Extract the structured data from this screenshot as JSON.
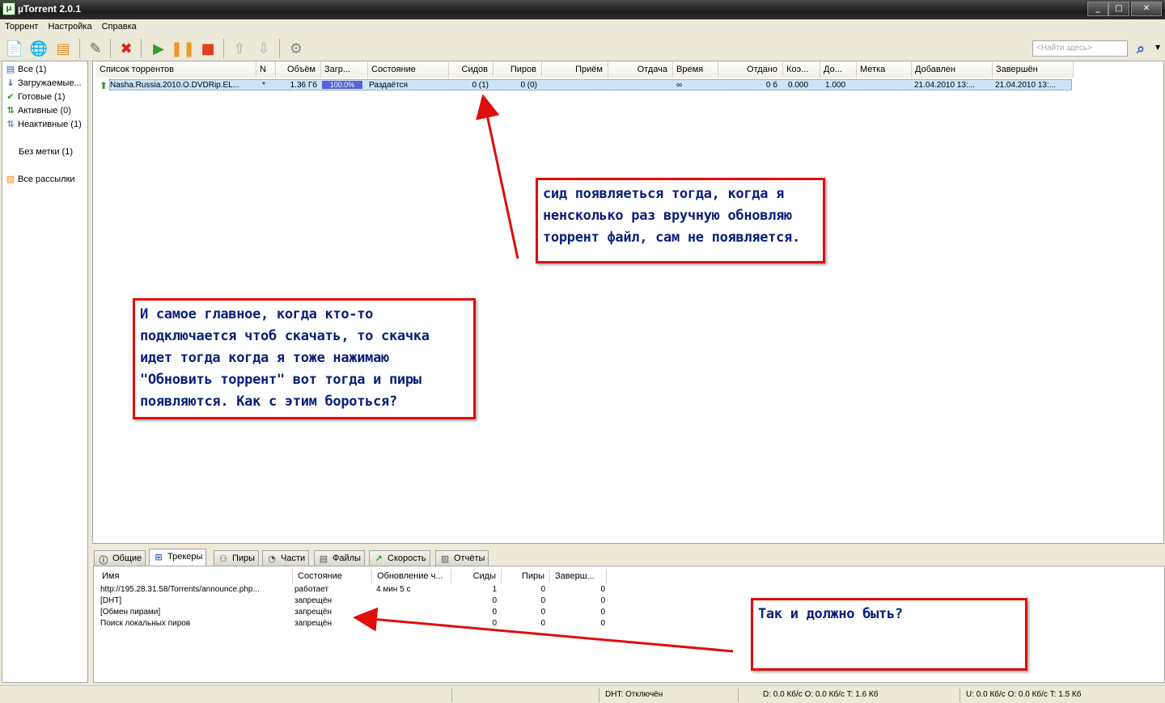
{
  "window": {
    "title": "µTorrent 2.0.1",
    "app_icon": "µ"
  },
  "menu": [
    "Торрент",
    "Настройка",
    "Справка"
  ],
  "toolbar": {
    "search_placeholder": "<Найти здесь>"
  },
  "sidebar": {
    "items": [
      {
        "label": "Все (1)",
        "icon": "all-icon"
      },
      {
        "label": "Загружаемые...",
        "icon": "download-icon"
      },
      {
        "label": "Готовые (1)",
        "icon": "check-icon"
      },
      {
        "label": "Активные (0)",
        "icon": "active-icon"
      },
      {
        "label": "Неактивные (1)",
        "icon": "inactive-icon"
      }
    ],
    "labels_item": "Без метки (1)",
    "feeds_item": "Все рассылки"
  },
  "torrent_list": {
    "columns": [
      "Список торрентов",
      "N",
      "Объём",
      "Загр...",
      "Состояние",
      "Сидов",
      "Пиров",
      "Приём",
      "Отдача",
      "Время",
      "Отдано",
      "Коэ...",
      "До...",
      "Метка",
      "Добавлен",
      "Завершён"
    ],
    "rows": [
      {
        "name": "Nasha.Russia.2010.O.DVDRip.EL...",
        "n": "*",
        "size": "1.36 Гб",
        "done": "100.0%",
        "done_fraction": 1.0,
        "status": "Раздаётся",
        "seeds": "0 (1)",
        "peers": "0 (0)",
        "down": "",
        "up": "",
        "eta": "∞",
        "uploaded": "0 б",
        "ratio": "0.000",
        "avail": "1.000",
        "label": "",
        "added": "21.04.2010 13:...",
        "completed": "21.04.2010 13:..."
      }
    ]
  },
  "tabs": [
    {
      "label": "Общие",
      "icon": "info-icon",
      "active": false
    },
    {
      "label": "Трекеры",
      "icon": "trackers-icon",
      "active": true
    },
    {
      "label": "Пиры",
      "icon": "peers-icon",
      "active": false
    },
    {
      "label": "Части",
      "icon": "pieces-icon",
      "active": false
    },
    {
      "label": "Файлы",
      "icon": "files-icon",
      "active": false
    },
    {
      "label": "Скорость",
      "icon": "speed-icon",
      "active": false
    },
    {
      "label": "Отчёты",
      "icon": "logger-icon",
      "active": false
    }
  ],
  "trackers": {
    "columns": [
      "Имя",
      "Состояние",
      "Обновление ч...",
      "Сиды",
      "Пиры",
      "Заверш..."
    ],
    "rows": [
      {
        "name": "http://195.28.31.58/Torrents/announce.php...",
        "status": "работает",
        "update": "4 мин 5 с",
        "seeds": "1",
        "peers": "0",
        "done": "0"
      },
      {
        "name": "[DHT]",
        "status": "запрещён",
        "update": "",
        "seeds": "0",
        "peers": "0",
        "done": "0"
      },
      {
        "name": "[Обмен пирами]",
        "status": "запрещён",
        "update": "",
        "seeds": "0",
        "peers": "0",
        "done": "0"
      },
      {
        "name": "Поиск локальных пиров",
        "status": "запрещён",
        "update": "",
        "seeds": "0",
        "peers": "0",
        "done": "0"
      }
    ]
  },
  "statusbar": {
    "dht": "DHT: Отключён",
    "down": "D: 0.0 Кб/с O: 0.0 Кб/с T: 1.6 Кб",
    "up": "U: 0.0 Кб/с O: 0.0 Кб/с T: 1.5 Кб"
  },
  "annotations": {
    "note1": [
      "сид появляеться тогда, когда я",
      "ненсколько раз вручную обновляю",
      "торрент файл, сам не появляется."
    ],
    "note2": [
      "И самое главное, когда кто-то",
      "подключается чтоб скачать, то скачка",
      "идет тогда когда я тоже нажимаю",
      "\"Обновить торрент\" вот тогда и пиры",
      "появляются. Как с этим бороться?"
    ],
    "note3": [
      "Так и должно быть?"
    ]
  },
  "colors": {
    "annotation_border": "#e00d0d",
    "annotation_text": "#0a1f78",
    "selection": "#cde3f7",
    "progress": "#5a63d8"
  }
}
